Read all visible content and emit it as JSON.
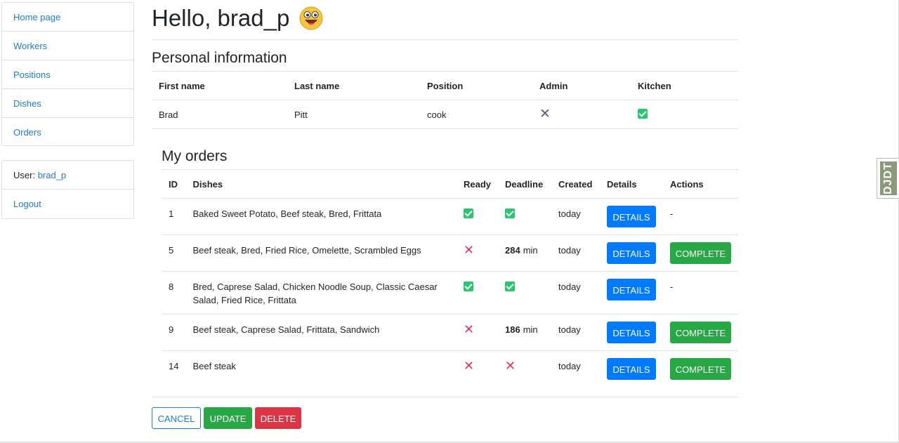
{
  "sidebar": {
    "items": [
      {
        "label": "Home page"
      },
      {
        "label": "Workers"
      },
      {
        "label": "Positions"
      },
      {
        "label": "Dishes"
      },
      {
        "label": "Orders"
      }
    ],
    "user_label": "User:",
    "username": "brad_p",
    "logout": "Logout"
  },
  "greeting": "Hello, brad_p",
  "personal": {
    "title": "Personal information",
    "headers": [
      "First name",
      "Last name",
      "Position",
      "Admin",
      "Kitchen"
    ],
    "first_name": "Brad",
    "last_name": "Pitt",
    "position": "cook",
    "admin": false,
    "kitchen": true
  },
  "orders": {
    "title": "My orders",
    "headers": [
      "ID",
      "Dishes",
      "Ready",
      "Deadline",
      "Created",
      "Details",
      "Actions"
    ],
    "details_label": "DETAILS",
    "complete_label": "COMPLETE",
    "rows": [
      {
        "id": "1",
        "dishes": "Baked Sweet Potato, Beef steak, Bred, Frittata",
        "ready": true,
        "deadline_ok": true,
        "deadline_min": "",
        "created": "today",
        "action": "-"
      },
      {
        "id": "5",
        "dishes": "Beef steak, Bred, Fried Rice, Omelette, Scrambled Eggs",
        "ready": false,
        "deadline_ok": null,
        "deadline_min": "284",
        "created": "today",
        "action": "COMPLETE"
      },
      {
        "id": "8",
        "dishes": "Bred, Caprese Salad, Chicken Noodle Soup, Classic Caesar Salad, Fried Rice, Frittata",
        "ready": true,
        "deadline_ok": true,
        "deadline_min": "",
        "created": "today",
        "action": "-"
      },
      {
        "id": "9",
        "dishes": "Beef steak, Caprese Salad, Frittata, Sandwich",
        "ready": false,
        "deadline_ok": null,
        "deadline_min": "186",
        "created": "today",
        "action": "COMPLETE"
      },
      {
        "id": "14",
        "dishes": "Beef steak",
        "ready": false,
        "deadline_ok": false,
        "deadline_min": "",
        "created": "today",
        "action": "COMPLETE"
      }
    ],
    "min_unit": "min"
  },
  "actions": {
    "cancel": "CANCEL",
    "update": "UPDATE",
    "delete": "DELETE"
  },
  "toolbar": {
    "label": "DJDT"
  },
  "colors": {
    "link": "#1f7bd1",
    "primary": "#007bff",
    "success": "#28a745",
    "danger": "#dc3545",
    "check": "#28c76f",
    "cross": "#e8345a"
  }
}
